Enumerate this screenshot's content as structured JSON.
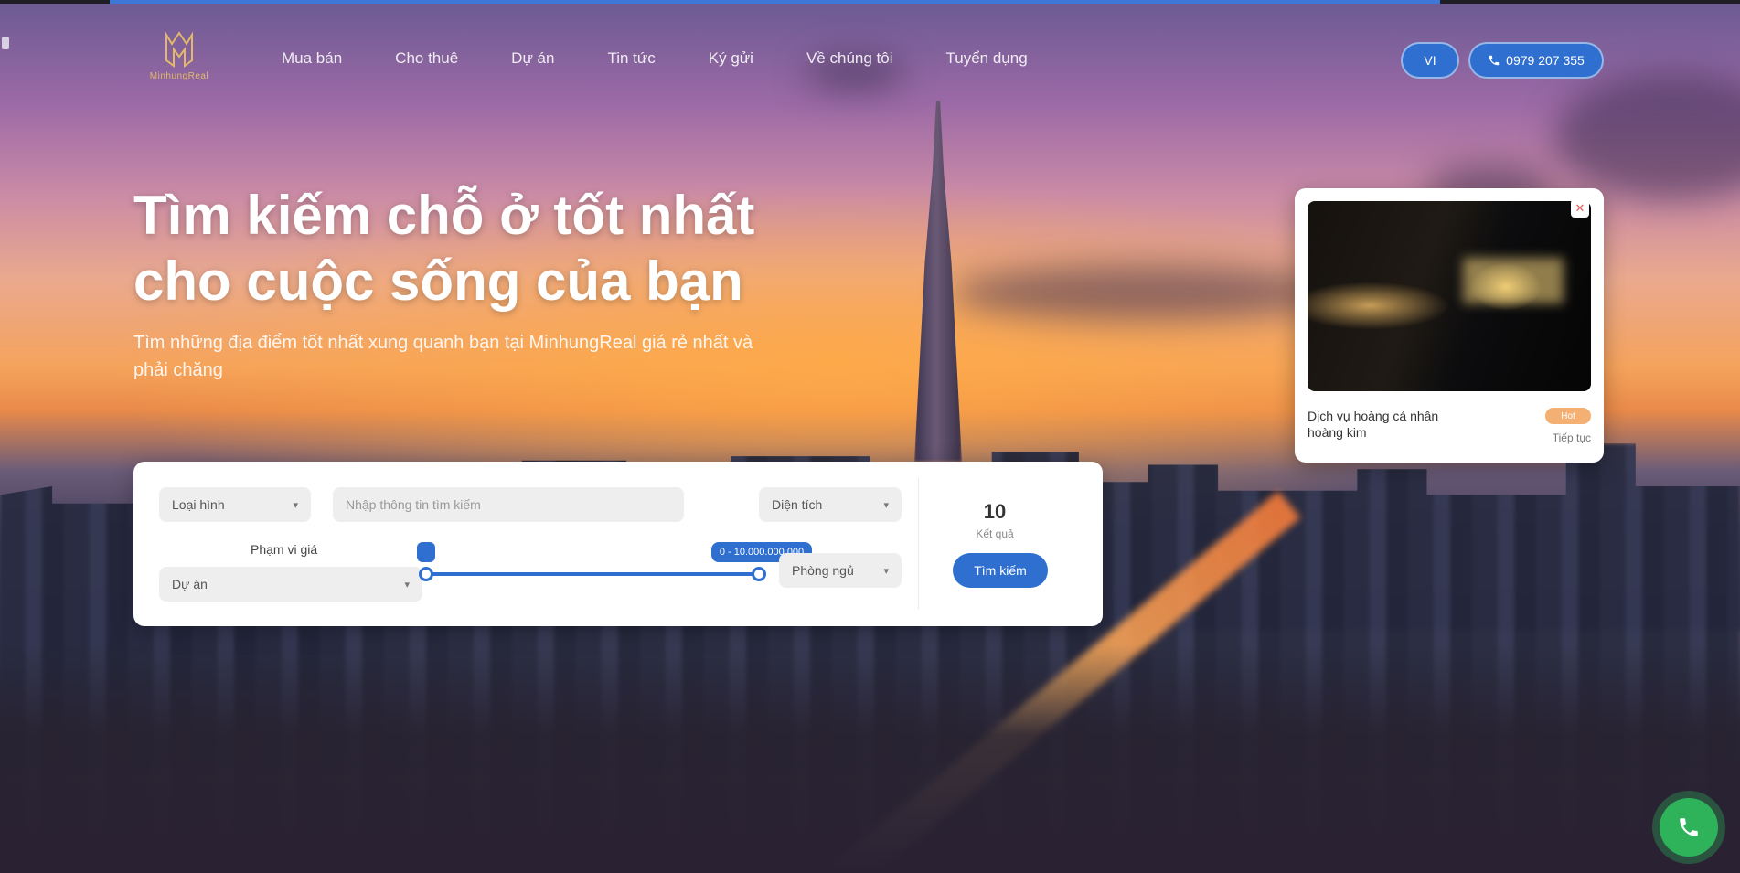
{
  "brand": {
    "name": "MinhungReal",
    "accent": "#2f6fd0",
    "logo_color": "#e3b86b"
  },
  "nav": {
    "items": [
      "Mua bán",
      "Cho thuê",
      "Dự án",
      "Tin tức",
      "Ký gửi",
      "Về chúng tôi",
      "Tuyển dụng"
    ]
  },
  "header": {
    "lang_label": "VI",
    "phone_label": "0979 207 355",
    "phone_icon": "phone-icon"
  },
  "hero": {
    "title_line1": "Tìm kiếm chỗ ở tốt nhất",
    "title_line2": "cho cuộc sống của bạn",
    "subtitle": "Tìm những địa điểm tốt nhất xung quanh bạn tại MinhungReal giá rẻ nhất và phải chăng"
  },
  "search": {
    "type_label": "Loại hình",
    "keyword_placeholder": "Nhập thông tin tìm kiếm",
    "area_label": "Diện tích",
    "price_label": "Phạm vi giá",
    "project_label": "Dự án",
    "rooms_label": "Phòng ngủ",
    "price_max_label": "0 - 10.000.000.000",
    "price_range_fraction": [
      0,
      1
    ],
    "result_count": "10",
    "result_label": "Kết quả",
    "search_button": "Tìm kiếm"
  },
  "promo": {
    "title": "Dịch vụ hoàng cá nhân hoàng kim",
    "badge": "Hot",
    "link_label": "Tiếp tục",
    "close_icon": "close-icon"
  },
  "fab": {
    "icon": "phone-icon",
    "color": "#2fb35a"
  }
}
